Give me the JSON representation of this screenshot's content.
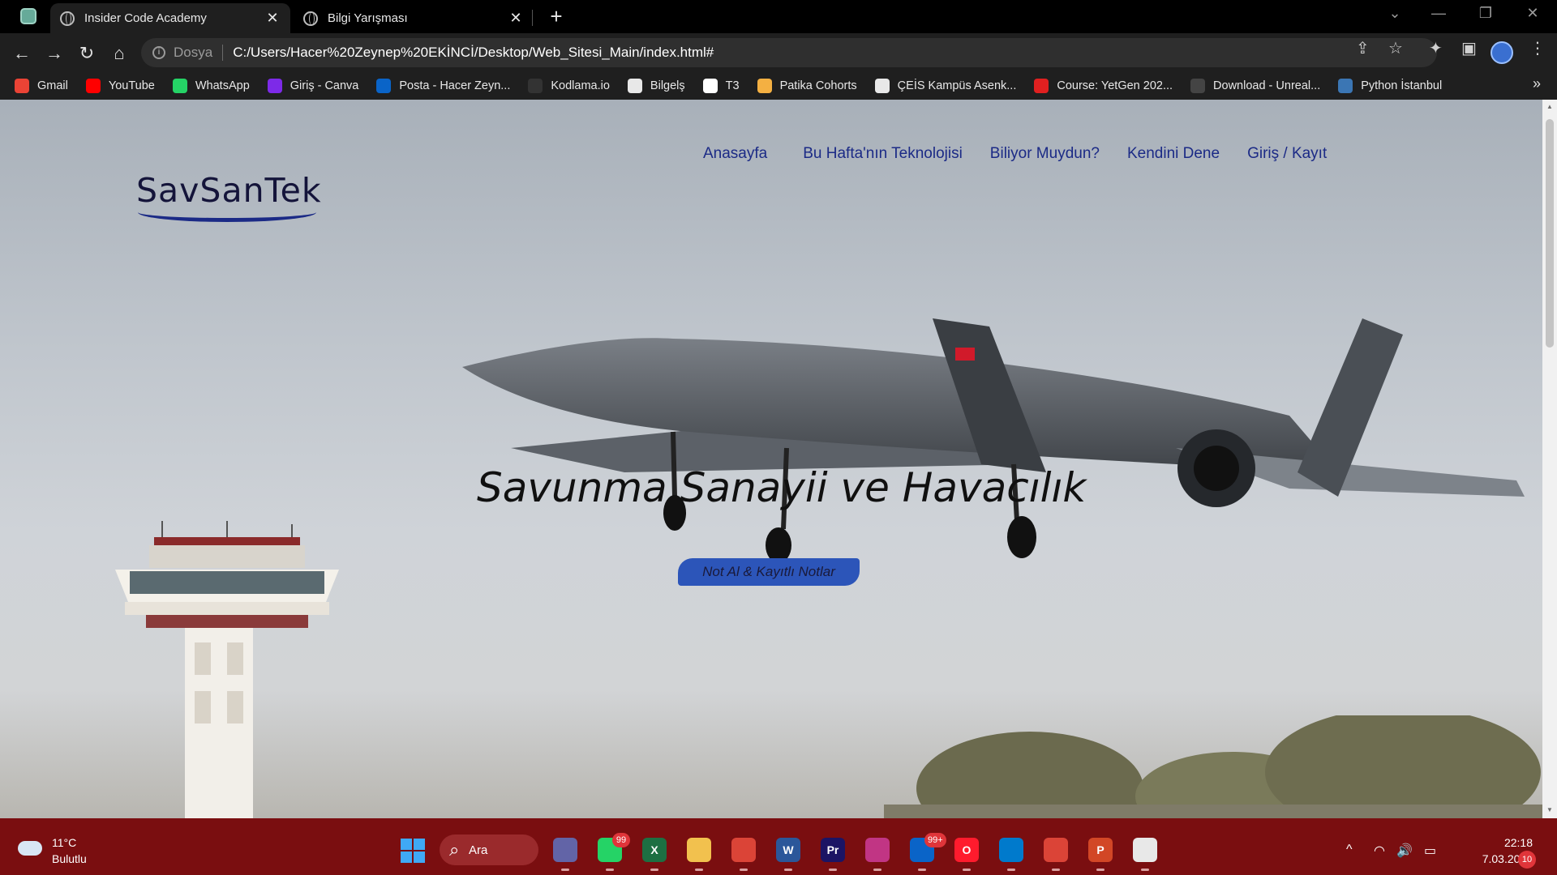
{
  "browser": {
    "tabs": [
      {
        "title": "Insider Code Academy",
        "active": true
      },
      {
        "title": "Bilgi Yarışması",
        "active": false
      }
    ],
    "new_tab_symbol": "+",
    "close_symbol": "✕",
    "window_controls": {
      "dropdown": "⌄",
      "minimize": "—",
      "restore": "❐",
      "close": "✕"
    },
    "nav": {
      "back": "←",
      "forward": "→",
      "reload": "↻",
      "home": "⌂"
    },
    "address": {
      "scheme_label": "Dosya",
      "url": "C:/Users/Hacer%20Zeynep%20EKİNCİ/Desktop/Web_Sitesi_Main/index.html#"
    },
    "toolbar_icons": {
      "share": "⇪",
      "star": "☆",
      "extensions": "✦",
      "side_panel": "▣",
      "menu": "⋮"
    }
  },
  "bookmarks": [
    {
      "label": "Gmail",
      "icon": "gmail-icon",
      "color": "#ea4335"
    },
    {
      "label": "YouTube",
      "icon": "youtube-icon",
      "color": "#ff0000"
    },
    {
      "label": "WhatsApp",
      "icon": "whatsapp-icon",
      "color": "#25d366"
    },
    {
      "label": "Giriş - Canva",
      "icon": "canva-icon",
      "color": "#7d2ae8"
    },
    {
      "label": "Posta - Hacer Zeyn...",
      "icon": "outlook-icon",
      "color": "#0a64c8"
    },
    {
      "label": "Kodlama.io",
      "icon": "kodlama-icon",
      "color": "#333333"
    },
    {
      "label": "Bilgelş",
      "icon": "globe-icon",
      "color": "#e8e8e8"
    },
    {
      "label": "T3",
      "icon": "t3-icon",
      "color": "#ffffff"
    },
    {
      "label": "Patika Cohorts",
      "icon": "patika-icon",
      "color": "#f4b042"
    },
    {
      "label": "ÇEİS Kampüs Asenk...",
      "icon": "globe-icon",
      "color": "#e8e8e8"
    },
    {
      "label": "Course: YetGen 202...",
      "icon": "yetgen-icon",
      "color": "#e02020"
    },
    {
      "label": "Download - Unreal...",
      "icon": "unreal-icon",
      "color": "#444444"
    },
    {
      "label": "Python İstanbul",
      "icon": "python-icon",
      "color": "#3b76b4"
    }
  ],
  "bookmarks_more": "»",
  "site": {
    "logo": "SavSanTek",
    "nav": [
      "Anasayfa",
      "Bu Hafta'nın Teknolojisi",
      "Biliyor Muydun?",
      "Kendini Dene",
      "Giriş / Kayıt"
    ],
    "hero_title": "Savunma Sanayii ve Havacılık",
    "hero_button": "Not Al & Kayıtlı Notlar",
    "colors": {
      "nav": "#1b2a86",
      "button": "#2c55b9",
      "logo_underline": "#1b2a86"
    }
  },
  "taskbar": {
    "weather": {
      "temp": "11°C",
      "desc": "Bulutlu"
    },
    "search_label": "Ara",
    "apps": [
      {
        "name": "teams-icon",
        "label": "",
        "color": "#6264a7"
      },
      {
        "name": "whatsapp-icon",
        "label": "",
        "color": "#25d366",
        "badge": "99"
      },
      {
        "name": "excel-icon",
        "label": "X",
        "color": "#1d6f42"
      },
      {
        "name": "file-explorer-icon",
        "label": "",
        "color": "#f2c14e"
      },
      {
        "name": "chrome-icon",
        "label": "",
        "color": "#db4437"
      },
      {
        "name": "word-icon",
        "label": "W",
        "color": "#2b579a"
      },
      {
        "name": "premiere-icon",
        "label": "Pr",
        "color": "#1b1464"
      },
      {
        "name": "instagram-icon",
        "label": "",
        "color": "#c13584"
      },
      {
        "name": "outlook-icon",
        "label": "",
        "color": "#0a64c8",
        "badge": "99+"
      },
      {
        "name": "opera-icon",
        "label": "O",
        "color": "#ff1b2d"
      },
      {
        "name": "vscode-icon",
        "label": "",
        "color": "#007acc"
      },
      {
        "name": "chrome-profile-icon",
        "label": "",
        "color": "#db4437"
      },
      {
        "name": "powerpoint-icon",
        "label": "P",
        "color": "#d24726"
      },
      {
        "name": "snipping-tool-icon",
        "label": "",
        "color": "#e8e8e8"
      }
    ],
    "tray": {
      "chevron": "^",
      "wifi": "◠",
      "volume": "🔊",
      "battery": "▭"
    },
    "clock": {
      "time": "22:18",
      "date": "7.03.2023"
    },
    "notifications": "10"
  }
}
